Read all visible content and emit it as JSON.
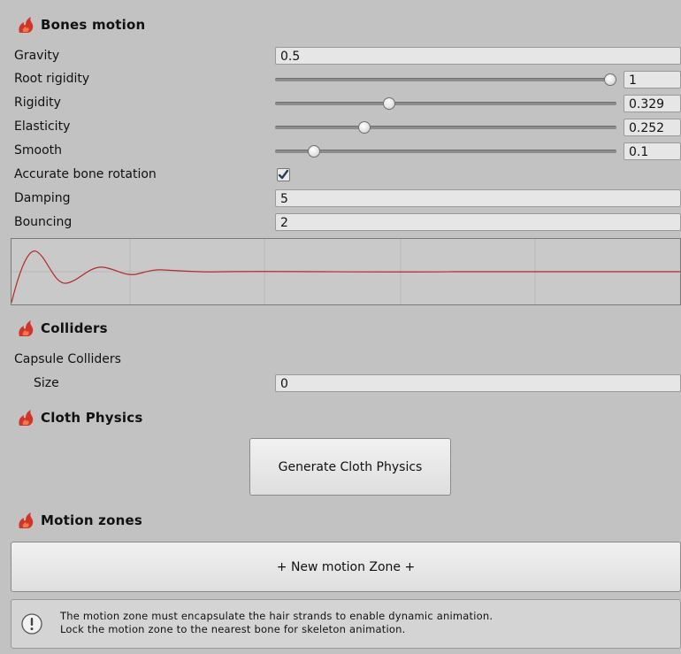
{
  "bones_motion": {
    "title": "Bones motion",
    "gravity": {
      "label": "Gravity",
      "value": "0.5"
    },
    "root_rigidity": {
      "label": "Root rigidity",
      "value": "1",
      "level": 1.0
    },
    "rigidity": {
      "label": "Rigidity",
      "value": "0.329",
      "level": 0.329
    },
    "elasticity": {
      "label": "Elasticity",
      "value": "0.252",
      "level": 0.252
    },
    "smooth": {
      "label": "Smooth",
      "value": "0.1",
      "level": 0.1
    },
    "accurate_rotation": {
      "label": "Accurate bone rotation",
      "checked": true
    },
    "damping": {
      "label": "Damping",
      "value": "5"
    },
    "bouncing": {
      "label": "Bouncing",
      "value": "2"
    },
    "curve_color": "#b22a2a"
  },
  "colliders": {
    "title": "Colliders",
    "capsule_label": "Capsule Colliders",
    "size": {
      "label": "Size",
      "value": "0"
    }
  },
  "cloth": {
    "title": "Cloth Physics",
    "button_label": "Generate Cloth Physics"
  },
  "motion_zones": {
    "title": "Motion zones",
    "new_button_label": "+ New motion Zone +",
    "help_line1": "The motion zone must encapsulate the hair strands to enable dynamic animation.",
    "help_line2": "Lock the motion zone to the nearest bone for skeleton animation."
  },
  "icons": {
    "section": "flame-icon",
    "help": "info-icon"
  },
  "colors": {
    "accent": "#d2342a",
    "background": "#c2c2c2"
  }
}
